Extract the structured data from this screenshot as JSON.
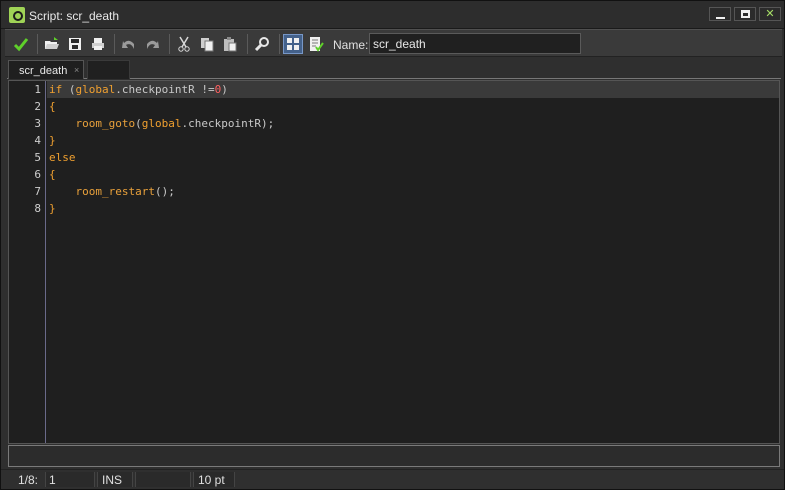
{
  "window": {
    "title": "Script: scr_death",
    "controls": {
      "minimize": "",
      "maximize": "",
      "close": "✕"
    }
  },
  "toolbar": {
    "buttons": [
      {
        "name": "ok-button",
        "icon": "checkmark-icon"
      },
      {
        "name": "open-button",
        "icon": "folder-open-icon"
      },
      {
        "name": "save-button",
        "icon": "floppy-disk-icon"
      },
      {
        "name": "print-button",
        "icon": "printer-icon"
      },
      {
        "name": "undo-button",
        "icon": "undo-icon"
      },
      {
        "name": "redo-button",
        "icon": "redo-icon"
      },
      {
        "name": "cut-button",
        "icon": "scissors-icon"
      },
      {
        "name": "copy-button",
        "icon": "copy-icon"
      },
      {
        "name": "paste-button",
        "icon": "paste-icon"
      },
      {
        "name": "find-button",
        "icon": "magnifier-icon"
      },
      {
        "name": "toggle-panel-button",
        "icon": "grid-icon"
      },
      {
        "name": "check-script-button",
        "icon": "document-check-icon"
      }
    ],
    "name_label": "Name:",
    "name_value": "scr_death"
  },
  "tabs": [
    {
      "label": "scr_death",
      "close": "×"
    }
  ],
  "editor": {
    "line_numbers": [
      "1",
      "2",
      "3",
      "4",
      "5",
      "6",
      "7",
      "8"
    ],
    "current_line": 1,
    "lines": [
      "if (global.checkpointR !=0)",
      "{",
      "    room_goto(global.checkpointR);",
      "}",
      "else",
      "{",
      "    room_restart();",
      "}"
    ],
    "tokens": {
      "l1_kw": "if",
      "l1_open": " (",
      "l1_global": "global",
      "l1_dot": ".",
      "l1_var": "checkpointR",
      "l1_op": " !=",
      "l1_num": "0",
      "l1_close": ")",
      "l2": "{",
      "l3_indent": "    ",
      "l3_fn": "room_goto",
      "l3_open": "(",
      "l3_global": "global",
      "l3_dot": ".",
      "l3_var": "checkpointR",
      "l3_close": ");",
      "l4": "}",
      "l5": "else",
      "l6": "{",
      "l7_indent": "    ",
      "l7_fn": "room_restart",
      "l7_rest": "();",
      "l8": "}"
    }
  },
  "status": {
    "position": "1/8:",
    "column": "1",
    "mode": "INS",
    "blank": "",
    "font_size": "10 pt"
  },
  "colors": {
    "keyword": "#f0a030",
    "identifier": "#c8c8c8",
    "number": "#ff6060",
    "current_line_bg": "#3a3a3a",
    "editor_bg": "#1f1f1f"
  }
}
